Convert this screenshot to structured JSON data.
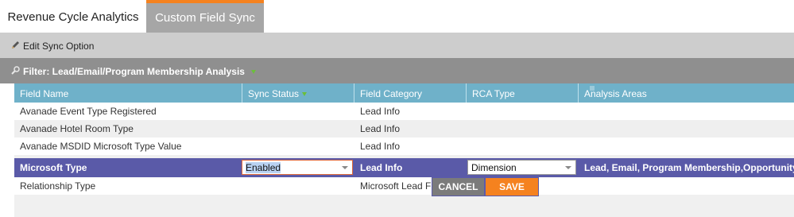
{
  "tabs": [
    {
      "label": "Revenue Cycle Analytics",
      "active": false
    },
    {
      "label": "Custom Field Sync",
      "active": true
    }
  ],
  "toolbar": {
    "edit_label": "Edit Sync Option",
    "edit_icon": "pencil-icon"
  },
  "filter": {
    "label": "Filter: Lead/Email/Program Membership Analysis",
    "icon": "filter-icon"
  },
  "colors": {
    "accent": "#f5821f",
    "header": "#6fb1c9",
    "selected_row": "#5a5aa8"
  },
  "grid": {
    "columns": [
      "Field Name",
      "Sync Status",
      "Field Category",
      "RCA Type",
      "Analysis Areas"
    ],
    "rows": [
      {
        "field_name": "Avanade Event Type Registered",
        "sync_status": "",
        "field_category": "Lead Info",
        "rca_type": "",
        "analysis_areas": ""
      },
      {
        "field_name": "Avanade Hotel Room Type",
        "sync_status": "",
        "field_category": "Lead Info",
        "rca_type": "",
        "analysis_areas": ""
      },
      {
        "field_name": "Avanade MSDID Microsoft Type Value",
        "sync_status": "",
        "field_category": "Lead Info",
        "rca_type": "",
        "analysis_areas": ""
      },
      {
        "field_name": "Microsoft Type",
        "sync_status": "Enabled",
        "field_category": "Lead Info",
        "rca_type": "Dimension",
        "analysis_areas": "Lead, Email, Program Membership,Opportunity"
      },
      {
        "field_name": "Relationship Type",
        "sync_status": "",
        "field_category": "Microsoft Lead Fie",
        "rca_type": "",
        "analysis_areas": ""
      }
    ]
  },
  "editor": {
    "cancel_label": "CANCEL",
    "save_label": "SAVE"
  }
}
